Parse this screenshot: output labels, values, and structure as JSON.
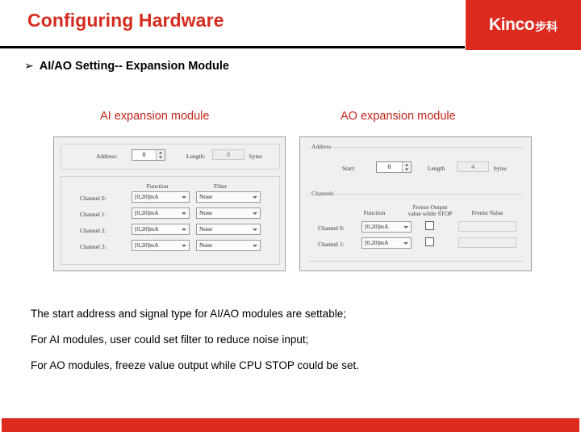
{
  "header": {
    "title": "Configuring Hardware",
    "logo_name": "Kinco",
    "logo_cn": "步科",
    "brand_red": "#DC2A1E"
  },
  "bullet": {
    "glyph": "➢",
    "text": "AI/AO Setting-- Expansion Module"
  },
  "captions": {
    "ai": "AI expansion module",
    "ao": "AO expansion module",
    "color": "#C0241B"
  },
  "ai_module": {
    "address_label": "Address:",
    "address_value": "0",
    "length_label": "Length:",
    "length_value": "8",
    "bytes_label": "bytes",
    "col_function": "Function",
    "col_filter": "Filter",
    "rows": [
      {
        "channel": "Channel 0:",
        "function": "[0,20]mA",
        "filter": "None"
      },
      {
        "channel": "Channel 1:",
        "function": "[0,20]mA",
        "filter": "None"
      },
      {
        "channel": "Channel 2:",
        "function": "[0,20]mA",
        "filter": "None"
      },
      {
        "channel": "Channel 3:",
        "function": "[0,20]mA",
        "filter": "None"
      }
    ]
  },
  "ao_module": {
    "group_address": "Address",
    "start_label": "Start:",
    "start_value": "0",
    "length_label": "Length",
    "length_value": "4",
    "bytes_label": "bytes",
    "group_channels": "Channels",
    "col_function": "Function",
    "col_freeze_output_line1": "Freeze Output",
    "col_freeze_output_line2": "value while STOP",
    "col_freeze_value": "Freeze Value",
    "rows": [
      {
        "channel": "Channel 0:",
        "function": "[0,20]mA",
        "freeze_checked": false,
        "freeze_value": ""
      },
      {
        "channel": "Channel 1:",
        "function": "[0,20]mA",
        "freeze_checked": false,
        "freeze_value": ""
      }
    ]
  },
  "body": {
    "lines": [
      "The start address and signal type for AI/AO modules are settable;",
      "For AI modules, user could set filter to reduce noise input;",
      "For AO modules, freeze value output while CPU STOP could be set."
    ]
  }
}
